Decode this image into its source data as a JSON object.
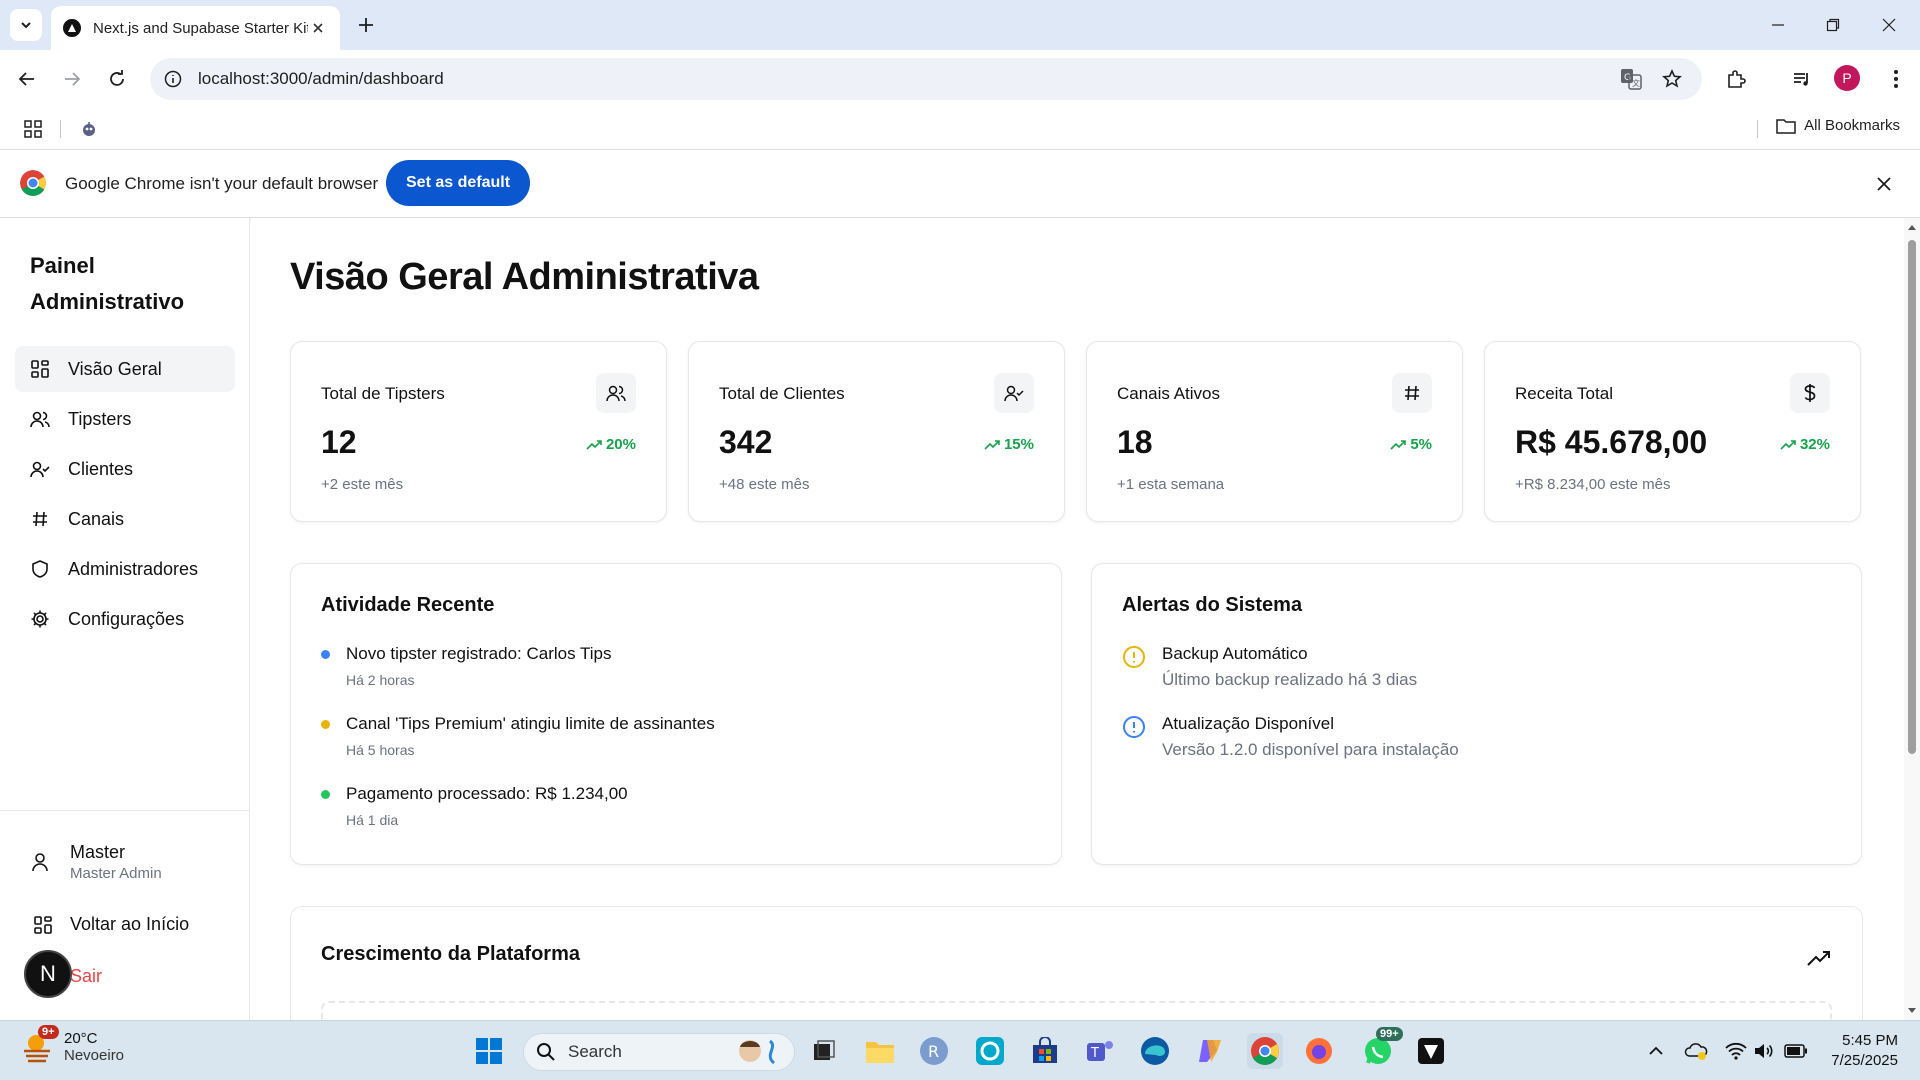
{
  "browser": {
    "tab_title": "Next.js and Supabase Starter Kit",
    "url": "localhost:3000/admin/dashboard",
    "profile_initial": "P",
    "all_bookmarks": "All Bookmarks"
  },
  "infobar": {
    "message": "Google Chrome isn't your default browser",
    "button": "Set as default"
  },
  "sidebar": {
    "brand_line1": "Painel",
    "brand_line2": "Administrativo",
    "items": [
      {
        "label": "Visão Geral",
        "icon": "layout-grid-icon",
        "active": true
      },
      {
        "label": "Tipsters",
        "icon": "users-icon"
      },
      {
        "label": "Clientes",
        "icon": "user-check-icon"
      },
      {
        "label": "Canais",
        "icon": "hash-icon"
      },
      {
        "label": "Administradores",
        "icon": "shield-icon"
      },
      {
        "label": "Configurações",
        "icon": "gear-icon"
      }
    ],
    "user_name": "Master",
    "user_role": "Master Admin",
    "back_home": "Voltar ao Início",
    "logout": "Sair",
    "next_badge": "N"
  },
  "main": {
    "title": "Visão Geral Administrativa",
    "stats": [
      {
        "label": "Total de Tipsters",
        "value": "12",
        "trend": "20%",
        "sub": "+2 este mês",
        "icon": "users-icon"
      },
      {
        "label": "Total de Clientes",
        "value": "342",
        "trend": "15%",
        "sub": "+48 este mês",
        "icon": "user-check-icon"
      },
      {
        "label": "Canais Ativos",
        "value": "18",
        "trend": "5%",
        "sub": "+1 esta semana",
        "icon": "hash-icon"
      },
      {
        "label": "Receita Total",
        "value": "R$ 45.678,00",
        "trend": "32%",
        "sub": "+R$ 8.234,00 este mês",
        "icon": "dollar-icon"
      }
    ],
    "activity": {
      "title": "Atividade Recente",
      "items": [
        {
          "text": "Novo tipster registrado: Carlos Tips",
          "time": "Há 2 horas",
          "color": "#3b82f6"
        },
        {
          "text": "Canal 'Tips Premium' atingiu limite de assinantes",
          "time": "Há 5 horas",
          "color": "#eab308"
        },
        {
          "text": "Pagamento processado: R$ 1.234,00",
          "time": "Há 1 dia",
          "color": "#22c55e"
        }
      ]
    },
    "alerts": {
      "title": "Alertas do Sistema",
      "items": [
        {
          "title": "Backup Automático",
          "desc": "Último backup realizado há 3 dias",
          "color": "#eab308"
        },
        {
          "title": "Atualização Disponível",
          "desc": "Versão 1.2.0 disponível para instalação",
          "color": "#3b82f6"
        }
      ]
    },
    "growth_title": "Crescimento da Plataforma"
  },
  "taskbar": {
    "temp": "20°C",
    "condition": "Nevoeiro",
    "weather_badge": "9+",
    "search": "Search",
    "whatsapp_badge": "99+",
    "time": "5:45 PM",
    "date": "7/25/2025"
  },
  "colors": {
    "accent": "#0b57d0",
    "trend_up": "#16a34a",
    "logout": "#ef4444"
  }
}
